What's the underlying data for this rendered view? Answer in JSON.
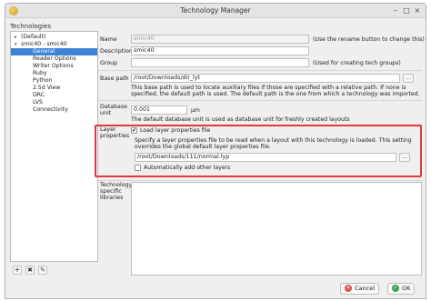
{
  "window": {
    "title": "Technology Manager"
  },
  "sidebar": {
    "heading": "Technologies",
    "items": [
      {
        "label": "(Default)",
        "arrow": "▸"
      },
      {
        "label": "smic40 - smic40",
        "arrow": "▾"
      },
      {
        "label": "General",
        "selected": true
      },
      {
        "label": "Reader Options"
      },
      {
        "label": "Writer Options"
      },
      {
        "label": "Ruby"
      },
      {
        "label": "Python"
      },
      {
        "label": "2.5d View"
      },
      {
        "label": "DRC"
      },
      {
        "label": "LVS"
      },
      {
        "label": "Connectivity"
      }
    ],
    "buttons": [
      {
        "icon": "plus-icon",
        "glyph": "+"
      },
      {
        "icon": "delete-icon",
        "glyph": "✖"
      },
      {
        "icon": "rename-icon",
        "glyph": "✎"
      }
    ]
  },
  "general": {
    "name": {
      "label": "Name",
      "value": "smic40",
      "hint": "(Use the rename button to change this)"
    },
    "description": {
      "label": "Description",
      "value": "smic40"
    },
    "group": {
      "label": "Group",
      "value": "",
      "hint": "(Used for creating tech groups)"
    },
    "base_path": {
      "label": "Base path",
      "value": "/root/Downloads/dir_lyt",
      "button": "...",
      "note": "This base path is used to locate auxiliary files if those are specified with a relative path. If none is specified, the default path is used. The default path is the one from which a technology was imported."
    },
    "dbu": {
      "label_line1": "Database",
      "label_line2": "unit",
      "value": "0.001",
      "unit": "µm",
      "note": "The default database unit is used as database unit for freshly created layouts"
    },
    "layer_properties": {
      "label_line1": "Layer",
      "label_line2": "properties",
      "load_label": "Load layer properties file",
      "load_checked": true,
      "note": "Specify a layer properties file to be read when a layout with this technology is loaded. This setting overrides the global default layer properties file.",
      "file": "/root/Downloads/111/normal.lyp",
      "button": "...",
      "auto_add_label": "Automatically add other layers",
      "auto_add_checked": false
    },
    "tech_libs": {
      "label_line1": "Technology",
      "label_line2": "specific",
      "label_line3": "libraries"
    }
  },
  "footer": {
    "cancel_label": "Cancel",
    "ok_label": "OK"
  },
  "colors": {
    "selection": "#3d84d6",
    "highlight": "#e03a3a",
    "cancel": "#d9534f",
    "ok": "#3fa34d"
  }
}
